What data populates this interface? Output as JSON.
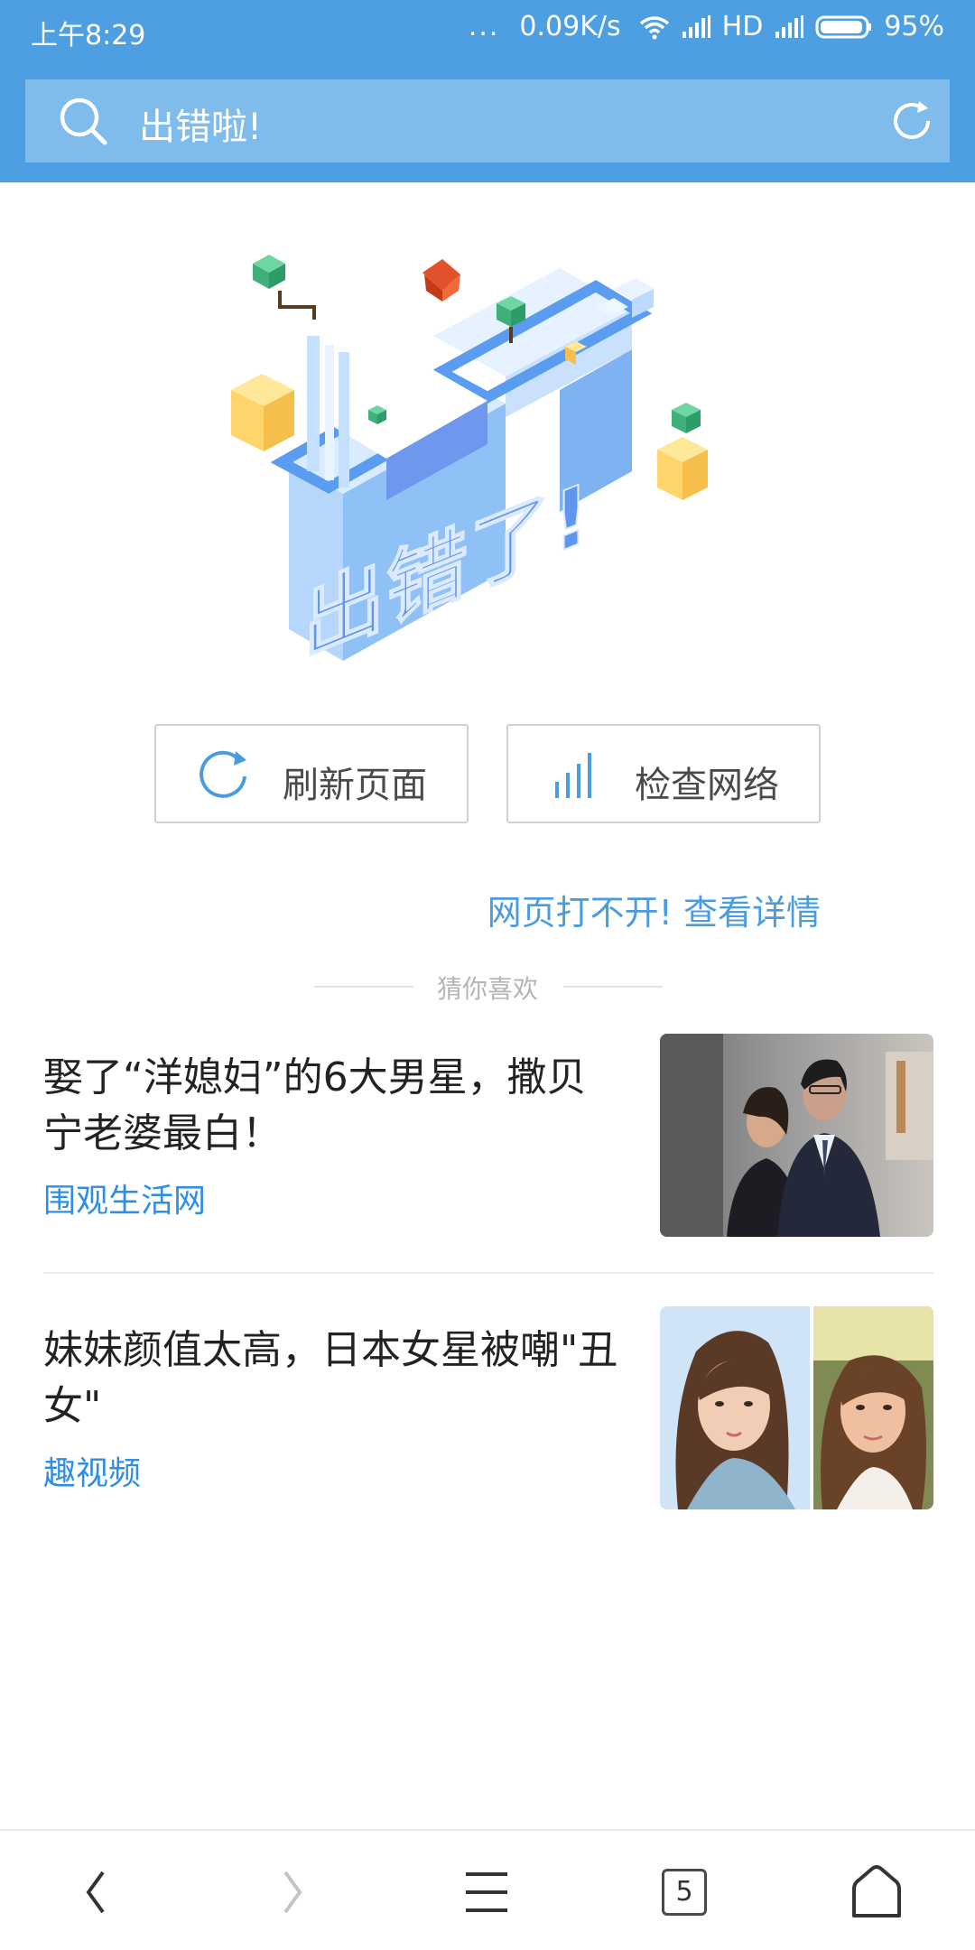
{
  "status_bar": {
    "time": "上午8:29",
    "more": "...",
    "network_speed": "0.09K/s",
    "hd_label": "HD",
    "battery": "95%",
    "battery_level": 0.95
  },
  "search": {
    "text": "出错啦!"
  },
  "illustration": {
    "icon": "isometric-error-illustration",
    "caption": "出错了!"
  },
  "actions": {
    "refresh_label": "刷新页面",
    "network_label": "检查网络",
    "detail_link": "网页打不开! 查看详情"
  },
  "recommend": {
    "heading": "猜你喜欢",
    "items": [
      {
        "title": "娶了“洋媳妇”的6大男星，撒贝宁老婆最白！",
        "source": "围观生活网"
      },
      {
        "title": "妹妹颜值太高，日本女星被嘲\"丑女\"",
        "source": "趣视频"
      }
    ]
  },
  "bottom_nav": {
    "tab_count": "5"
  },
  "colors": {
    "header": "#4e9fe2",
    "search_field": "#7fbcec",
    "link": "#4a9be0",
    "source": "#2f8de4"
  }
}
